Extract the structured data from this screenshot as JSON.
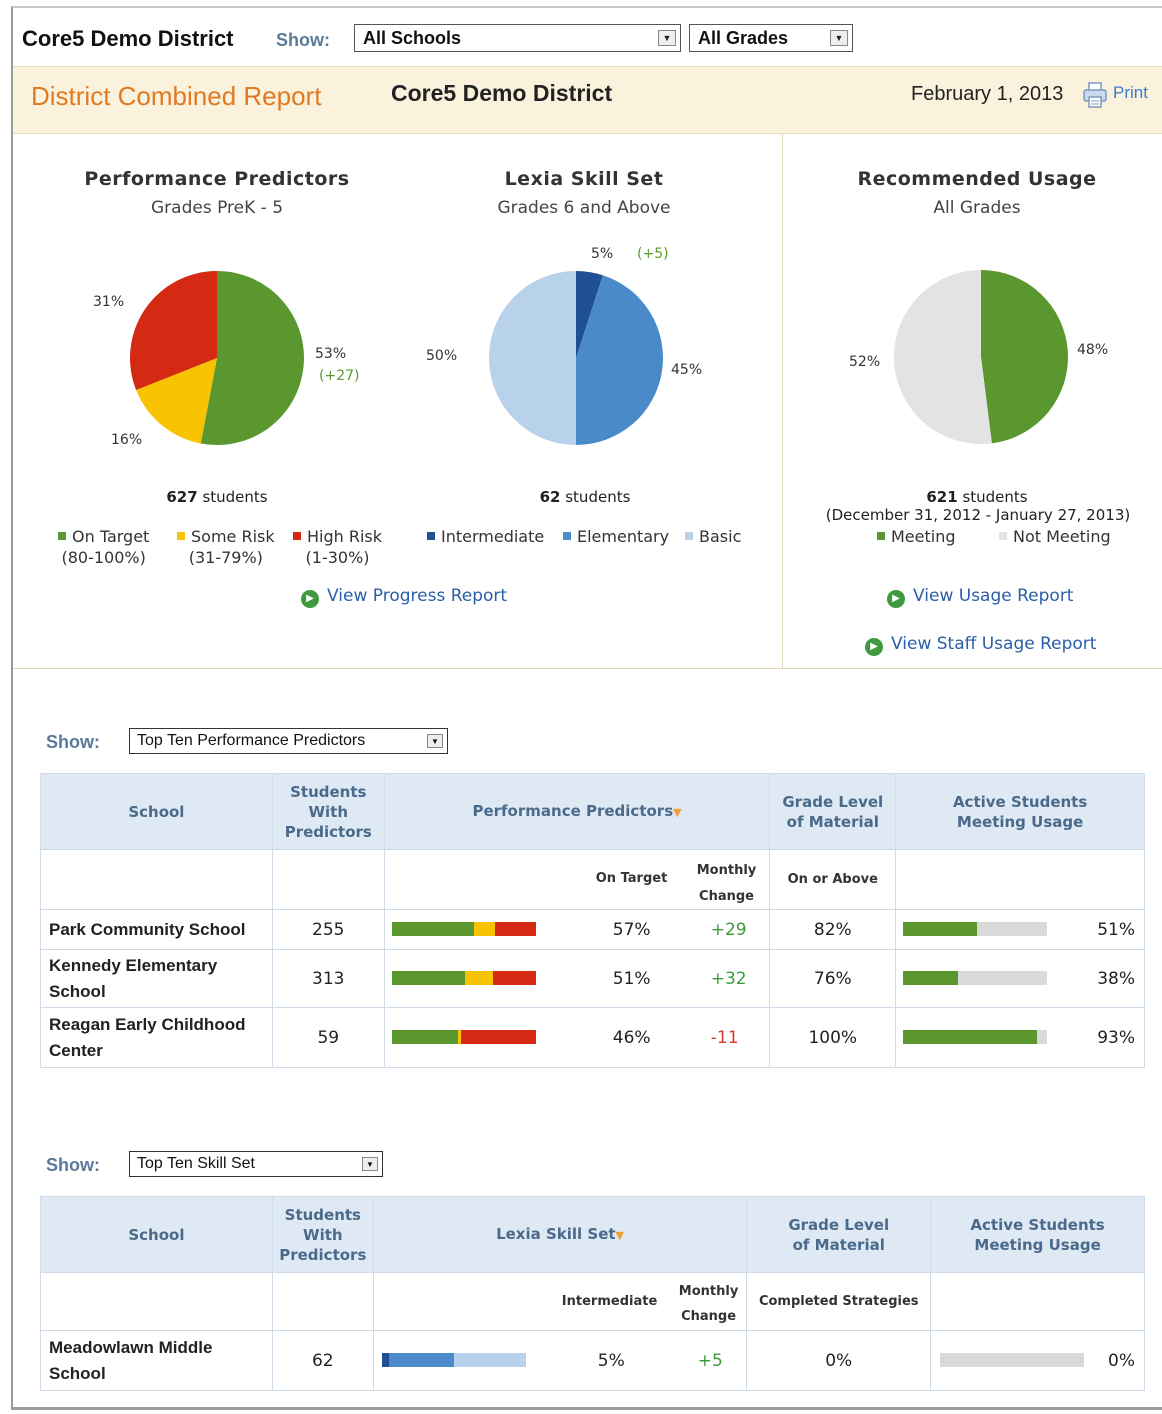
{
  "topbar": {
    "district": "Core5 Demo District",
    "show_label": "Show:",
    "school_select": "All Schools",
    "grade_select": "All Grades"
  },
  "report": {
    "title": "District Combined Report",
    "district": "Core5 Demo District",
    "date": "February 1, 2013",
    "print": "Print"
  },
  "colors": {
    "on_target": "#5a982f",
    "some_risk": "#f8c300",
    "high_risk": "#d42a14",
    "intermediate": "#1f4f95",
    "elementary": "#4b8ac8",
    "basic": "#b7d2ea",
    "meeting": "#5a982f",
    "not_meeting": "#e3e3e3",
    "accent_orange": "#e07a22",
    "link_blue": "#2a5ea8"
  },
  "charts": {
    "predictors": {
      "title": "Performance Predictors",
      "subtitle": "Grades PreK - 5",
      "students": "627",
      "students_suffix": " students",
      "labels": {
        "on_target": "53%",
        "on_target_change": "(+27)",
        "some_risk": "16%",
        "high_risk": "31%"
      },
      "legend": [
        {
          "name": "On Target",
          "range": "(80-100%)",
          "icon": "green-square"
        },
        {
          "name": "Some Risk",
          "range": "(31-79%)",
          "icon": "yellow-square"
        },
        {
          "name": "High Risk",
          "range": "(1-30%)",
          "icon": "red-square"
        }
      ]
    },
    "skillset": {
      "title": "Lexia Skill Set",
      "subtitle": "Grades 6 and Above",
      "students": "62",
      "students_suffix": " students",
      "labels": {
        "intermediate": "5%",
        "intermediate_change": "(+5)",
        "elementary": "45%",
        "basic": "50%"
      },
      "legend": [
        {
          "name": "Intermediate",
          "icon": "dark-blue-square"
        },
        {
          "name": "Elementary",
          "icon": "blue-square"
        },
        {
          "name": "Basic",
          "icon": "light-blue-square"
        }
      ]
    },
    "usage": {
      "title": "Recommended Usage",
      "subtitle": "All Grades",
      "students": "621",
      "students_suffix": " students",
      "period": "(December 31, 2012 - January 27, 2013)",
      "labels": {
        "meeting": "48%",
        "not_meeting": "52%"
      },
      "legend": [
        {
          "name": "Meeting",
          "icon": "green-square"
        },
        {
          "name": "Not Meeting",
          "icon": "grey-square"
        }
      ]
    },
    "links": {
      "progress": "View Progress Report",
      "usage": "View Usage Report",
      "staff_usage": "View Staff Usage Report"
    }
  },
  "chart_data": [
    {
      "type": "pie",
      "title": "Performance Predictors",
      "subtitle": "Grades PreK - 5",
      "categories": [
        "On Target",
        "Some Risk",
        "High Risk"
      ],
      "values": [
        53,
        16,
        31
      ],
      "annotations": [
        "(+27)"
      ]
    },
    {
      "type": "pie",
      "title": "Lexia Skill Set",
      "subtitle": "Grades 6 and Above",
      "categories": [
        "Intermediate",
        "Elementary",
        "Basic"
      ],
      "values": [
        5,
        45,
        50
      ],
      "annotations": [
        "(+5)"
      ]
    },
    {
      "type": "pie",
      "title": "Recommended Usage",
      "subtitle": "All Grades",
      "categories": [
        "Meeting",
        "Not Meeting"
      ],
      "values": [
        48,
        52
      ]
    }
  ],
  "table1": {
    "show_label": "Show:",
    "select": "Top Ten Performance Predictors",
    "headers": {
      "school": "School",
      "students_line1": "Students",
      "students_line2": "With",
      "students_line3": "Predictors",
      "predictors": "Performance Predictors",
      "grade_line1": "Grade Level",
      "grade_line2": "of Material",
      "active_line1": "Active Students",
      "active_line2": "Meeting Usage"
    },
    "subheaders": {
      "on_target": "On Target",
      "monthly_line1": "Monthly",
      "monthly_line2": "Change",
      "on_or_above": "On or Above"
    },
    "rows": [
      {
        "school_line1": "Park Community School",
        "school_line2": "",
        "students": "255",
        "dist": [
          0.57,
          0.15,
          0.28
        ],
        "on_target": "57%",
        "change": "+29",
        "grade": "82%",
        "usage": 0.51,
        "usage_text": "51%"
      },
      {
        "school_line1": "Kennedy Elementary",
        "school_line2": "School",
        "students": "313",
        "dist": [
          0.51,
          0.19,
          0.3
        ],
        "on_target": "51%",
        "change": "+32",
        "grade": "76%",
        "usage": 0.38,
        "usage_text": "38%"
      },
      {
        "school_line1": "Reagan Early Childhood",
        "school_line2": "Center",
        "students": "59",
        "dist": [
          0.46,
          0.02,
          0.52
        ],
        "on_target": "46%",
        "change": "-11",
        "grade": "100%",
        "usage": 0.93,
        "usage_text": "93%"
      }
    ]
  },
  "table2": {
    "show_label": "Show:",
    "select": "Top Ten Skill Set",
    "headers": {
      "school": "School",
      "students_line1": "Students",
      "students_line2": "With",
      "students_line3": "Predictors",
      "skillset": "Lexia Skill Set",
      "grade_line1": "Grade Level",
      "grade_line2": "of Material",
      "active_line1": "Active Students",
      "active_line2": "Meeting Usage"
    },
    "subheaders": {
      "intermediate": "Intermediate",
      "monthly_line1": "Monthly",
      "monthly_line2": "Change",
      "completed": "Completed Strategies"
    },
    "rows": [
      {
        "school_line1": "Meadowlawn Middle",
        "school_line2": "School",
        "students": "62",
        "dist": [
          0.05,
          0.45,
          0.5
        ],
        "intermediate": "5%",
        "change": "+5",
        "grade": "0%",
        "usage": 0.0,
        "usage_text": "0%"
      }
    ]
  }
}
